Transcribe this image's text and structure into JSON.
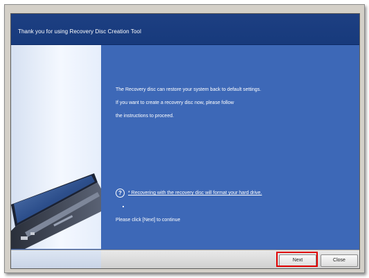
{
  "window": {
    "title": "Thank you for using Recovery Disc Creation Tool"
  },
  "main": {
    "description_lines": [
      "The Recovery disc can restore your system back to default settings.",
      "If you want to create a recovery disc now, please follow",
      "the instructions to proceed."
    ],
    "warning_link": "* Recovering with the recovery disc will format your hard drive.",
    "help_icon_glyph": "?",
    "continue_text": "Please click [Next] to continue"
  },
  "buttons": {
    "next_label": "Next",
    "close_label": "Close"
  },
  "colors": {
    "title_bar": "#173a7c",
    "content_bg": "#3d68b7",
    "highlight": "#e00000"
  },
  "icons": {
    "help": "question-circle-icon",
    "illustration": "laptop-illustration"
  }
}
